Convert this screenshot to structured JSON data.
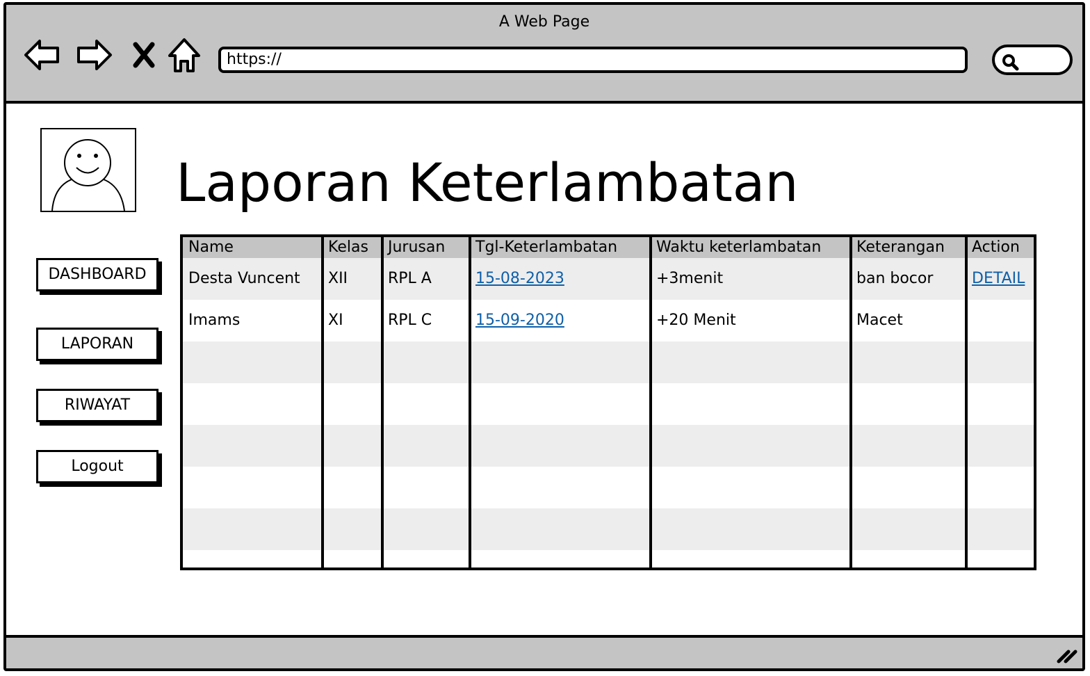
{
  "window": {
    "title": "A Web Page"
  },
  "toolbar": {
    "url": "https://"
  },
  "page": {
    "title": "Laporan Keterlambatan"
  },
  "sidebar": {
    "items": [
      {
        "label": "DASHBOARD"
      },
      {
        "label": "LAPORAN"
      },
      {
        "label": "RIWAYAT"
      },
      {
        "label": "Logout"
      }
    ]
  },
  "table": {
    "headers": [
      "Name",
      "Kelas",
      "Jurusan",
      "Tgl-Keterlambatan",
      "Waktu keterlambatan",
      "Keterangan",
      "Action"
    ],
    "rows": [
      {
        "name": "Desta Vuncent",
        "kelas": "XII",
        "jurusan": "RPL A",
        "tanggal": "15-08-2023",
        "waktu": "+3menit",
        "keterangan": "ban bocor",
        "action": "DETAIL"
      },
      {
        "name": "Imams",
        "kelas": "XI",
        "jurusan": "RPL C",
        "tanggal": "15-09-2020",
        "waktu": "+20 Menit",
        "keterangan": "Macet",
        "action": ""
      }
    ]
  },
  "colors": {
    "chrome": "#c4c4c4",
    "link": "#0f5fa8",
    "row_alt": "#ededed"
  },
  "icons": [
    "back-arrow-icon",
    "forward-arrow-icon",
    "close-icon",
    "home-icon",
    "search-icon",
    "resize-grip-icon",
    "user-avatar-icon"
  ]
}
